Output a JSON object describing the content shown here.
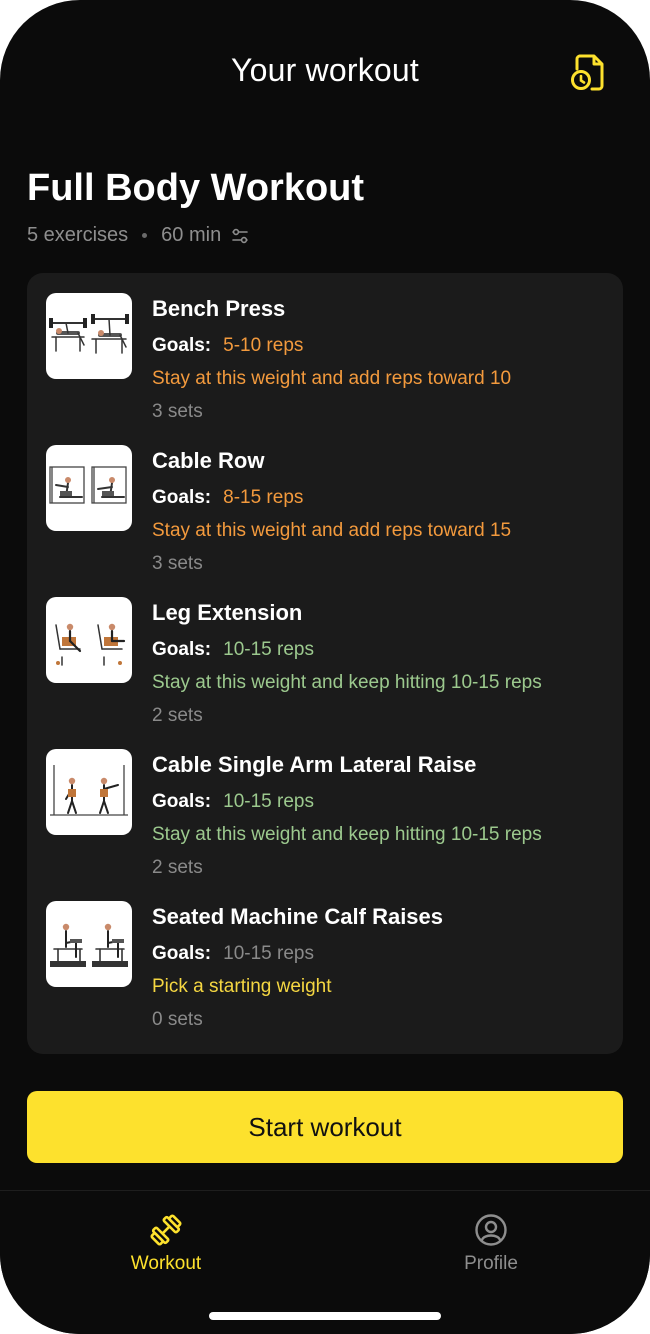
{
  "header": {
    "title": "Your workout",
    "history_icon": "clock-document-icon"
  },
  "workout": {
    "name": "Full Body Workout",
    "exercise_count": "5 exercises",
    "duration": "60 min",
    "settings_icon": "sliders-icon"
  },
  "exercises": [
    {
      "name": "Bench Press",
      "goals_label": "Goals:",
      "goals": "5-10 reps",
      "goals_color": "#f39a3d",
      "advice": "Stay at this weight and add reps toward 10",
      "advice_color": "#f39a3d",
      "sets": "3 sets",
      "thumbnail": "bench-press-illustration"
    },
    {
      "name": "Cable Row",
      "goals_label": "Goals:",
      "goals": "8-15 reps",
      "goals_color": "#f39a3d",
      "advice": "Stay at this weight and add reps toward 15",
      "advice_color": "#f39a3d",
      "sets": "3 sets",
      "thumbnail": "cable-row-illustration"
    },
    {
      "name": "Leg Extension",
      "goals_label": "Goals:",
      "goals": "10-15 reps",
      "goals_color": "#9cc98e",
      "advice": "Stay at this weight and keep hitting 10-15 reps",
      "advice_color": "#9cc98e",
      "sets": "2 sets",
      "thumbnail": "leg-extension-illustration"
    },
    {
      "name": "Cable Single Arm Lateral Raise",
      "goals_label": "Goals:",
      "goals": "10-15 reps",
      "goals_color": "#9cc98e",
      "advice": "Stay at this weight and keep hitting 10-15 reps",
      "advice_color": "#9cc98e",
      "sets": "2 sets",
      "thumbnail": "lateral-raise-illustration"
    },
    {
      "name": "Seated Machine Calf Raises",
      "goals_label": "Goals:",
      "goals": "10-15 reps",
      "goals_color": "#8a8a8a",
      "advice": "Pick a starting weight",
      "advice_color": "#f5d742",
      "sets": "0 sets",
      "thumbnail": "calf-raise-illustration"
    }
  ],
  "start_button": {
    "label": "Start workout"
  },
  "tabs": [
    {
      "label": "Workout",
      "icon": "dumbbell-icon",
      "active": true
    },
    {
      "label": "Profile",
      "icon": "user-circle-icon",
      "active": false
    }
  ],
  "colors": {
    "accent": "#fde12d",
    "background": "#0b0b0b",
    "card": "#1b1b1b",
    "warn": "#f39a3d",
    "good": "#9cc98e",
    "muted": "#8a8a8a"
  }
}
